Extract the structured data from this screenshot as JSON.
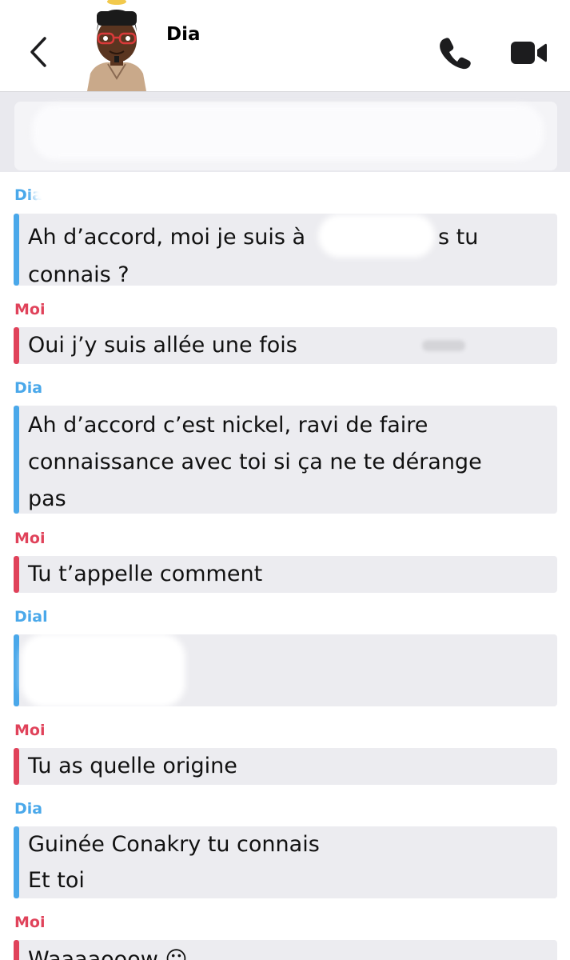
{
  "header": {
    "contact_name": "Dia",
    "back_icon": "chevron-left-icon",
    "call_icon": "phone-icon",
    "video_icon": "video-camera-icon"
  },
  "colors": {
    "me": "#e0425a",
    "them": "#4aa8ea",
    "bubble": "#ececf0"
  },
  "messages": [
    {
      "sender": "Dia",
      "lines": [
        "Ah d’accord, moi je suis à",
        "connais ?"
      ],
      "tail": "s tu"
    },
    {
      "sender": "Moi",
      "lines": [
        "Oui j’y suis allée une fois"
      ]
    },
    {
      "sender": "Dia",
      "lines": [
        "Ah d’accord c’est nickel, ravi de faire",
        "connaissance avec toi si ça ne te dérange",
        "pas"
      ]
    },
    {
      "sender": "Moi",
      "lines": [
        "Tu t’appelle comment"
      ]
    },
    {
      "sender": "Dial",
      "lines": [
        "",
        ""
      ]
    },
    {
      "sender": "Moi",
      "lines": [
        "Tu as quelle origine"
      ]
    },
    {
      "sender": "Dia",
      "lines": [
        "Guinée Conakry tu connais",
        "Et toi"
      ]
    },
    {
      "sender": "Moi",
      "lines": [
        "Waaaaooow 😶"
      ]
    }
  ]
}
